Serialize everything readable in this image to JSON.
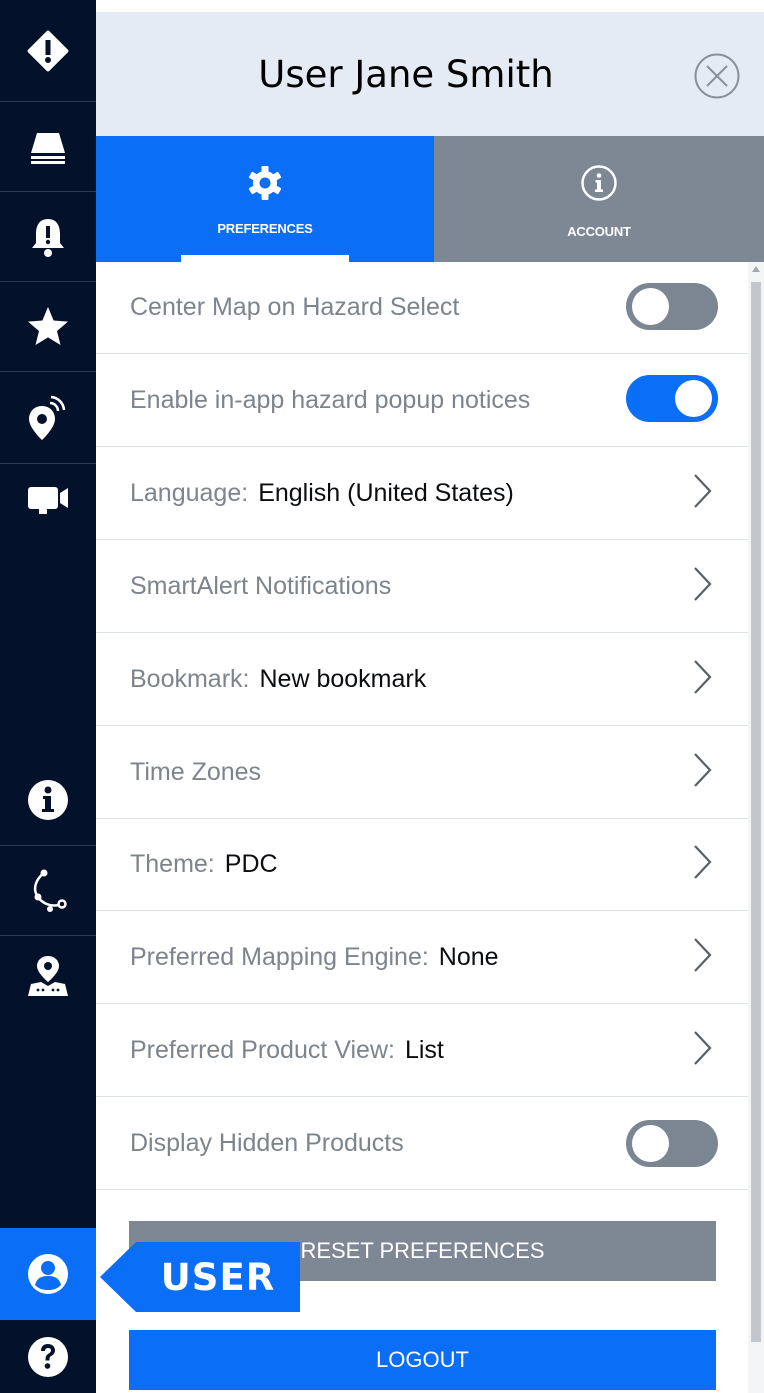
{
  "sidebar": {
    "items": [
      {
        "name": "hazards",
        "icon": "diamond-alert-icon"
      },
      {
        "name": "layers",
        "icon": "layers-icon"
      },
      {
        "name": "alerts",
        "icon": "bell-alert-icon"
      },
      {
        "name": "favorites",
        "icon": "star-icon"
      },
      {
        "name": "broadcast",
        "icon": "location-signal-icon"
      },
      {
        "name": "video",
        "icon": "video-camera-icon"
      },
      {
        "name": "info",
        "icon": "info-icon"
      },
      {
        "name": "measure",
        "icon": "measure-path-icon"
      },
      {
        "name": "map-pin",
        "icon": "map-pin-icon"
      },
      {
        "name": "user",
        "icon": "user-icon",
        "active": true
      },
      {
        "name": "help",
        "icon": "help-icon"
      }
    ]
  },
  "header": {
    "title": "User Jane Smith",
    "close_icon": "close-circle-icon"
  },
  "tabs": {
    "preferences": {
      "label": "PREFERENCES",
      "icon": "gear-icon",
      "active": true
    },
    "account": {
      "label": "ACCOUNT",
      "icon": "info-circle-icon"
    }
  },
  "settings": [
    {
      "label": "Center Map on Hazard Select",
      "type": "toggle",
      "on": false
    },
    {
      "label": "Enable in-app hazard popup notices",
      "type": "toggle",
      "on": true
    },
    {
      "label": "Language:",
      "value": "English (United States)",
      "type": "nav"
    },
    {
      "label": "SmartAlert Notifications",
      "value": "",
      "type": "nav"
    },
    {
      "label": "Bookmark:",
      "value": "New bookmark",
      "type": "nav"
    },
    {
      "label": "Time Zones",
      "value": "",
      "type": "nav"
    },
    {
      "label": "Theme:",
      "value": "PDC",
      "type": "nav"
    },
    {
      "label": "Preferred Mapping Engine:",
      "value": "None",
      "type": "nav"
    },
    {
      "label": "Preferred Product View:",
      "value": "List",
      "type": "nav"
    },
    {
      "label": "Display Hidden Products",
      "type": "toggle",
      "on": false
    }
  ],
  "buttons": {
    "reset": "RESET PREFERENCES",
    "logout": "LOGOUT"
  },
  "callout": {
    "text": "USER"
  },
  "colors": {
    "sidebar_bg": "#04112a",
    "accent": "#0b6ef6",
    "inactive_tab": "#7e8895",
    "header_bg": "#e5ebf4",
    "label_gray": "#7d848c"
  }
}
